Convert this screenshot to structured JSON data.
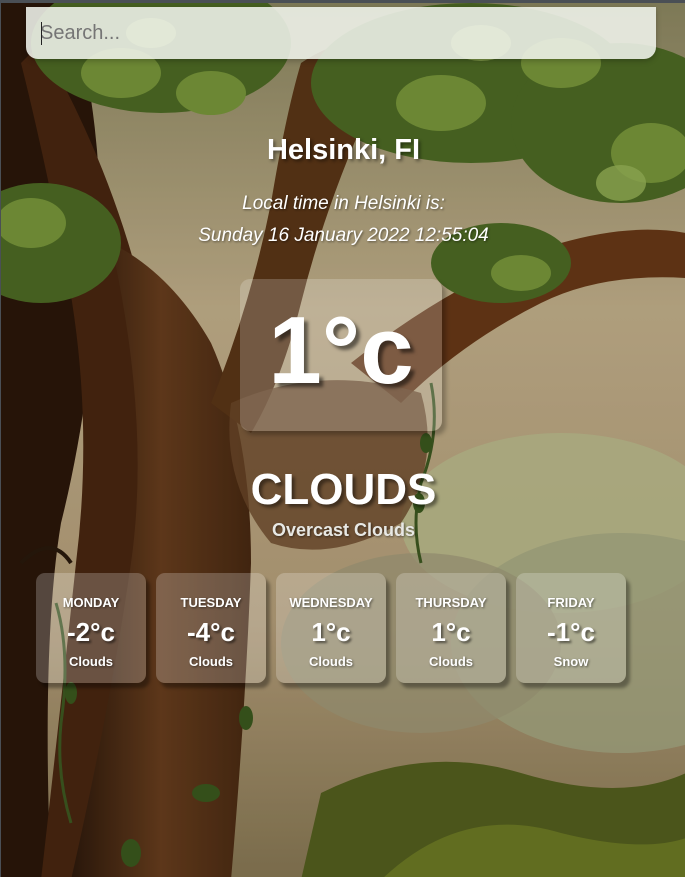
{
  "search": {
    "placeholder": "Search..."
  },
  "location": {
    "city": "Helsinki, FI",
    "local_time_label": "Local time in Helsinki is:",
    "local_time": "Sunday 16 January 2022 12:55:04"
  },
  "current": {
    "temperature": "1°c",
    "condition": "CLOUDS",
    "description": "Overcast Clouds"
  },
  "forecast": [
    {
      "day": "MONDAY",
      "temp": "-2°c",
      "condition": "Clouds"
    },
    {
      "day": "TUESDAY",
      "temp": "-4°c",
      "condition": "Clouds"
    },
    {
      "day": "WEDNESDAY",
      "temp": "1°c",
      "condition": "Clouds"
    },
    {
      "day": "THURSDAY",
      "temp": "1°c",
      "condition": "Clouds"
    },
    {
      "day": "FRIDAY",
      "temp": "-1°c",
      "condition": "Snow"
    }
  ],
  "colors": {
    "sky": "#c9b896",
    "trunk": "#5a3418",
    "foliage": "#5d7a2e",
    "ground": "#6b7a2a"
  }
}
